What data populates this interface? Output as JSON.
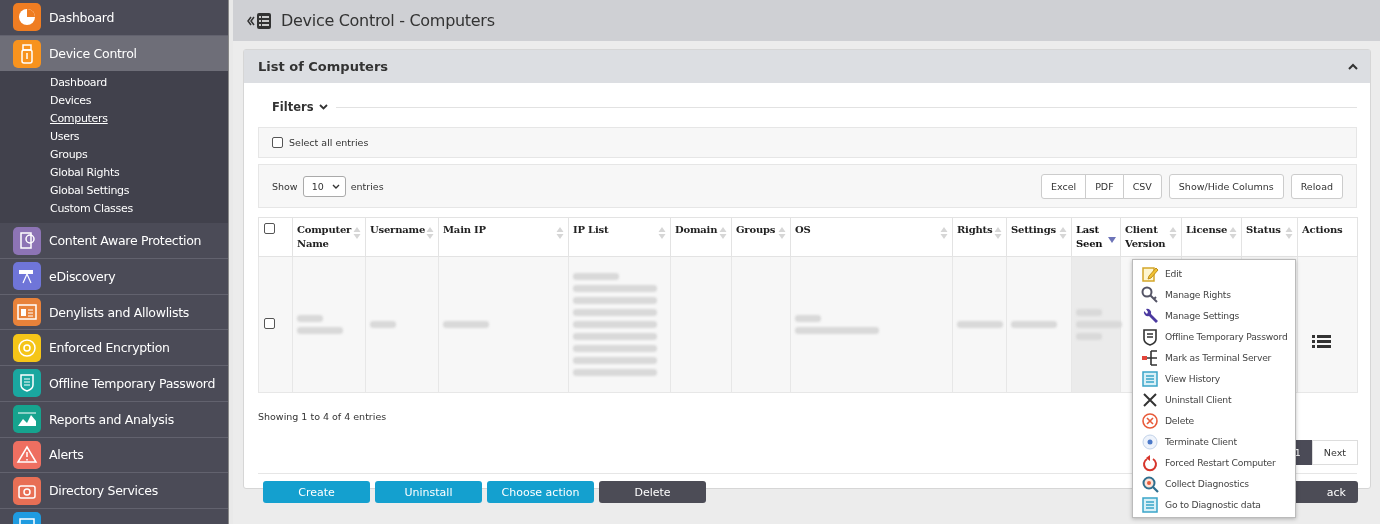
{
  "sidebar": {
    "items": [
      {
        "label": "Dashboard",
        "kind": "pie",
        "color": "#ef7d22",
        "selected": false
      },
      {
        "label": "Device Control",
        "kind": "usb",
        "color": "#f7931e",
        "selected": true,
        "expanded": true,
        "children": [
          {
            "label": "Dashboard",
            "selected": false
          },
          {
            "label": "Devices",
            "selected": false
          },
          {
            "label": "Computers",
            "selected": true
          },
          {
            "label": "Users",
            "selected": false
          },
          {
            "label": "Groups",
            "selected": false
          },
          {
            "label": "Global Rights",
            "selected": false
          },
          {
            "label": "Global Settings",
            "selected": false
          },
          {
            "label": "Custom Classes",
            "selected": false
          }
        ]
      },
      {
        "label": "Content Aware Protection",
        "kind": "doc",
        "color": "#8d74b5",
        "selected": false
      },
      {
        "label": "eDiscovery",
        "kind": "scope",
        "color": "#6f75d8",
        "selected": false
      },
      {
        "label": "Denylists and Allowlists",
        "kind": "list",
        "color": "#e8823a",
        "selected": false
      },
      {
        "label": "Enforced Encryption",
        "kind": "disc",
        "color": "#f5c518",
        "selected": false
      },
      {
        "label": "Offline Temporary Password",
        "kind": "shield",
        "color": "#1aa7a0",
        "selected": false
      },
      {
        "label": "Reports and Analysis",
        "kind": "chart",
        "color": "#16a38e",
        "selected": false
      },
      {
        "label": "Alerts",
        "kind": "warn",
        "color": "#ee6f61",
        "selected": false
      },
      {
        "label": "Directory Services",
        "kind": "case",
        "color": "#e86f55",
        "selected": false
      },
      {
        "kind": "blank",
        "color": "#1e9be0",
        "selected": false
      }
    ]
  },
  "header": {
    "title": "Device Control - Computers"
  },
  "panel": {
    "title": "List of Computers",
    "expanded": true
  },
  "filters": {
    "label": "Filters",
    "expanded": false
  },
  "select_all": {
    "label": "Select all entries",
    "checked": false
  },
  "length": {
    "before": "Show",
    "value": "10",
    "after": "entries"
  },
  "toolbar": [
    "Excel",
    "PDF",
    "CSV",
    "Show/Hide Columns",
    "Reload"
  ],
  "table": {
    "columns": [
      {
        "kind": "check",
        "checked": false
      },
      {
        "label": "Computer Name",
        "sortable": true,
        "sorted": false
      },
      {
        "label": "Username",
        "sortable": true,
        "sorted": false
      },
      {
        "label": "Main IP",
        "sortable": true,
        "sorted": false
      },
      {
        "label": "IP List",
        "sortable": true,
        "sorted": false
      },
      {
        "label": "Domain",
        "sortable": true,
        "sorted": false
      },
      {
        "label": "Groups",
        "sortable": true,
        "sorted": false
      },
      {
        "label": "OS",
        "sortable": true,
        "sorted": false
      },
      {
        "label": "Rights",
        "sortable": true,
        "sorted": false
      },
      {
        "label": "Settings",
        "sortable": true,
        "sorted": false
      },
      {
        "label": "Last Seen",
        "sortable": true,
        "sorted": true
      },
      {
        "label": "Client Version",
        "sortable": true,
        "sorted": false
      },
      {
        "label": "License",
        "sortable": true,
        "sorted": false
      },
      {
        "label": "Status",
        "sortable": true,
        "sorted": false
      },
      {
        "label": "Actions",
        "sortable": false,
        "sorted": false
      }
    ],
    "rows": [
      {
        "checked": false,
        "cells": [
          {
            "kind": "blurred"
          },
          {
            "kind": "blurred"
          },
          {
            "kind": "blurred"
          },
          {
            "kind": "blurred"
          },
          {
            "kind": "empty"
          },
          {
            "kind": "empty"
          },
          {
            "kind": "blurred"
          },
          {
            "kind": "blurred"
          },
          {
            "kind": "blurred"
          },
          {
            "kind": "blurred"
          },
          {
            "kind": "empty"
          },
          {
            "kind": "empty"
          },
          {
            "kind": "empty"
          },
          {
            "kind": "menu"
          }
        ]
      }
    ]
  },
  "info": "Showing 1 to 4 of 4 entries",
  "pagination": [
    {
      "label": "1",
      "selected": true
    },
    {
      "label": "Next",
      "selected": false
    }
  ],
  "actions": [
    {
      "label": "Create",
      "kind": "primary"
    },
    {
      "label": "Uninstall",
      "kind": "primary"
    },
    {
      "label": "Choose action",
      "kind": "primary"
    },
    {
      "label": "Delete",
      "kind": "dark"
    }
  ],
  "back_button": "ack",
  "context_menu": [
    {
      "label": "Edit",
      "kind": "edit"
    },
    {
      "label": "Manage Rights",
      "kind": "key"
    },
    {
      "label": "Manage Settings",
      "kind": "wrench"
    },
    {
      "label": "Offline Temporary Password",
      "kind": "shield"
    },
    {
      "label": "Mark as Terminal Server",
      "kind": "server"
    },
    {
      "label": "View History",
      "kind": "list"
    },
    {
      "label": "Uninstall Client",
      "kind": "x"
    },
    {
      "label": "Delete",
      "kind": "delete"
    },
    {
      "label": "Terminate Client",
      "kind": "dot"
    },
    {
      "label": "Forced Restart Computer",
      "kind": "restart"
    },
    {
      "label": "Collect Diagnostics",
      "kind": "magnify"
    },
    {
      "label": "Go to Diagnostic data",
      "kind": "list"
    }
  ]
}
